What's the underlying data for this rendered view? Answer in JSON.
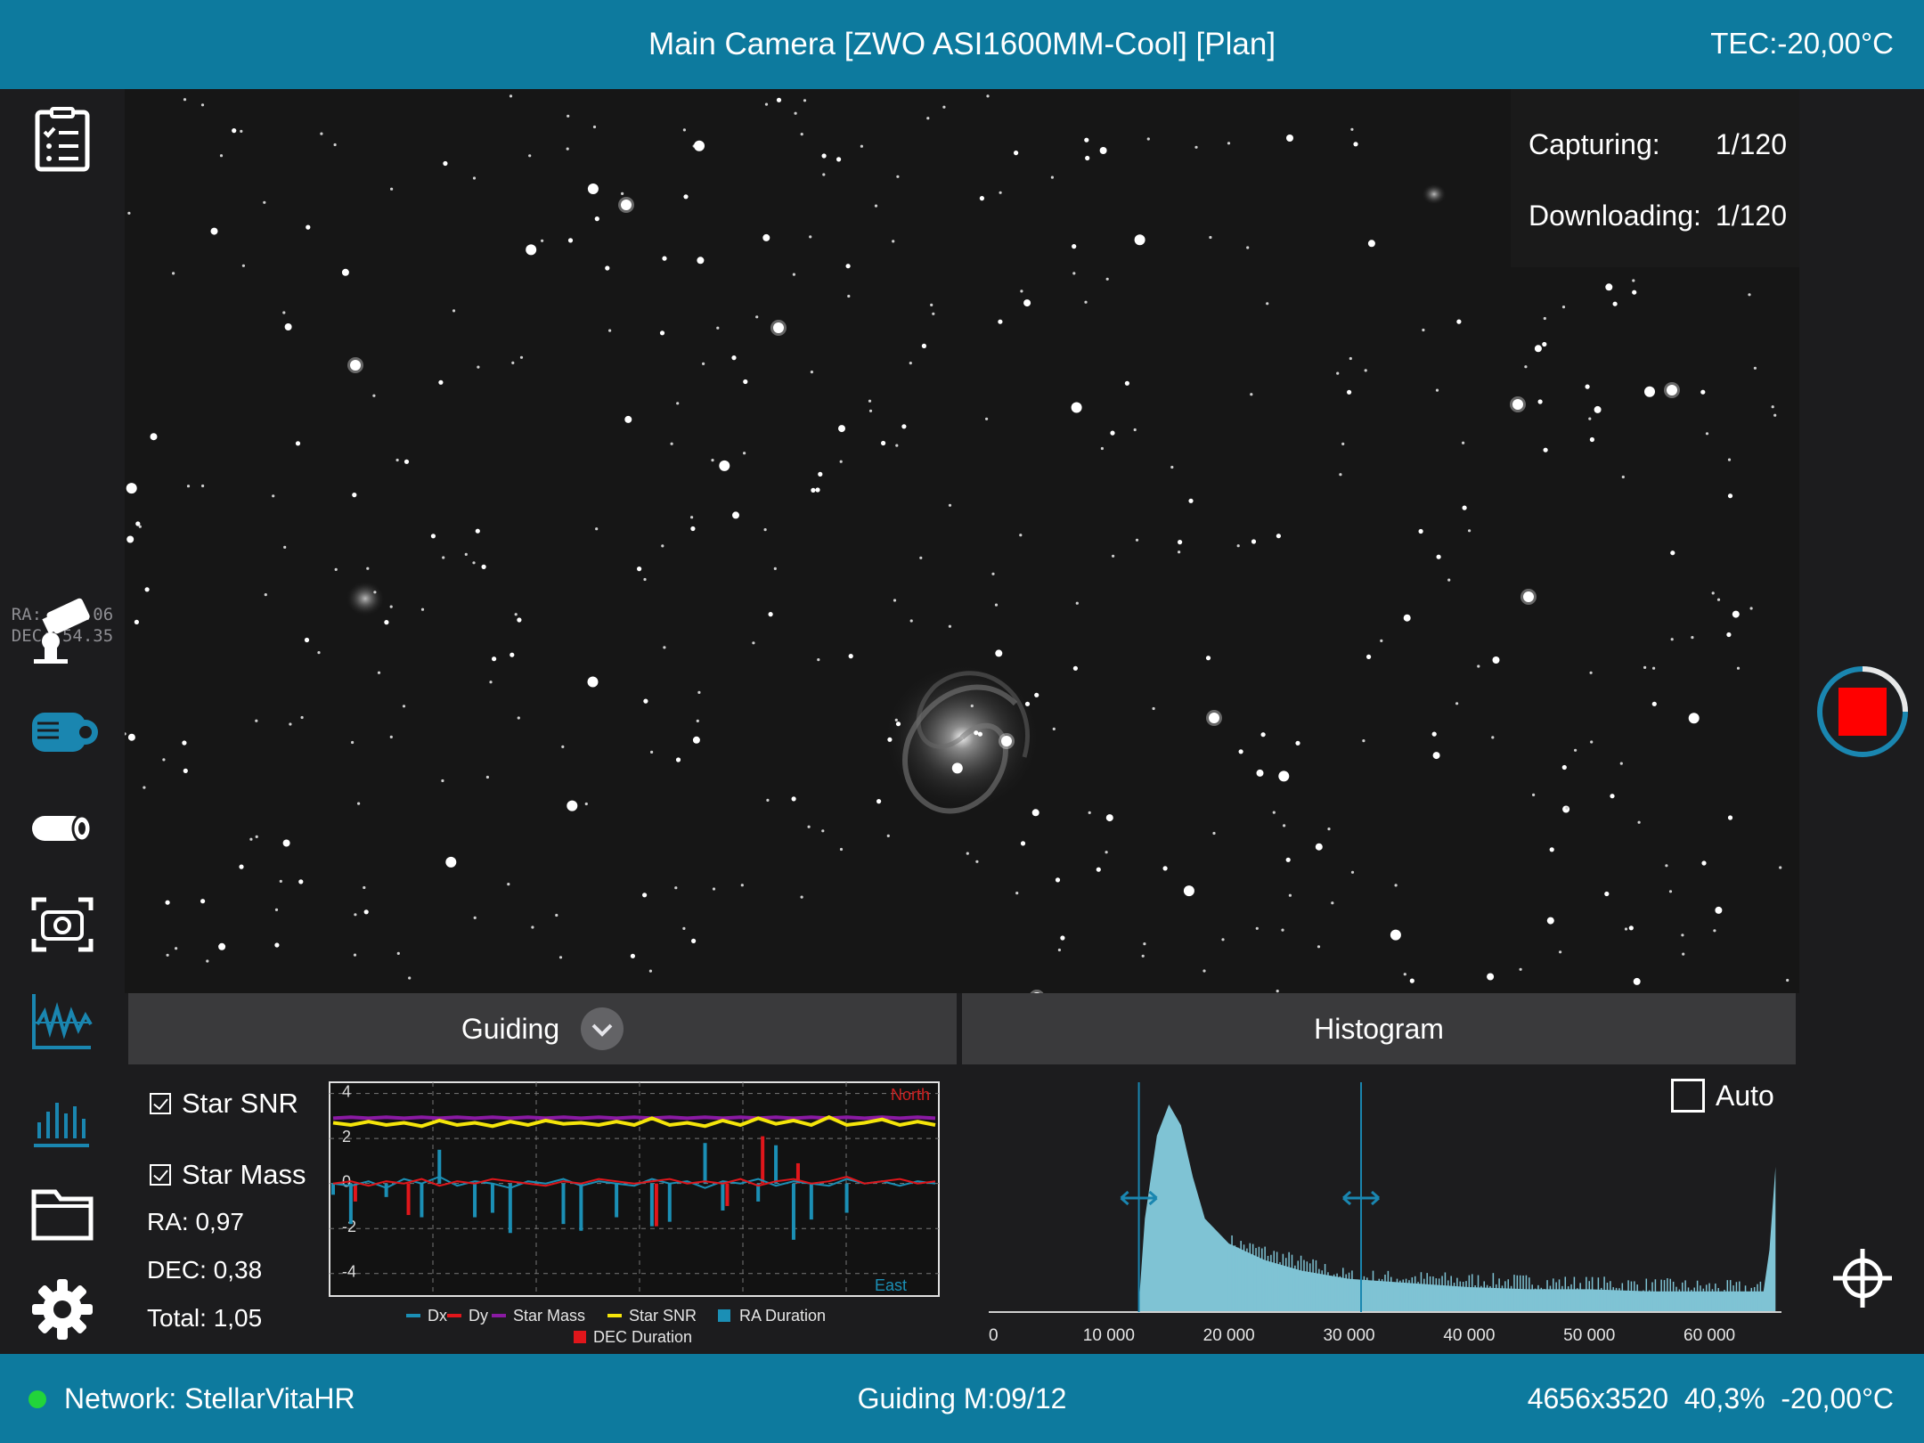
{
  "header": {
    "title": "Main Camera [ZWO ASI1600MM-Cool] [Plan]",
    "tec": "TEC:-20,00°C"
  },
  "sidebar": {
    "coords_ra": "RA:  14.06",
    "coords_dec": "DEC: 54.35",
    "icons": [
      "checklist-icon",
      "mount-icon",
      "camera-icon",
      "focuser-icon",
      "capture-focus-icon",
      "guiding-graph-icon",
      "histogram-icon",
      "folder-icon",
      "settings-gear-icon"
    ],
    "accent_color": "#1a86b0"
  },
  "capture_status": {
    "capturing_label": "Capturing:",
    "capturing_value": "1/120",
    "downloading_label": "Downloading:",
    "downloading_value": "1/120"
  },
  "guiding": {
    "header_label": "Guiding",
    "star_snr_label": "Star SNR",
    "star_mass_label": "Star Mass",
    "ra": "RA: 0,97",
    "dec": "DEC: 0,38",
    "total": "Total: 1,05",
    "north_label": "North",
    "east_label": "East"
  },
  "histogram": {
    "header_label": "Histogram",
    "auto_label": "Auto",
    "auto_checked": false
  },
  "statusbar": {
    "network": "Network: StellarVitaHR",
    "guiding": "Guiding M:09/12",
    "image_info": "4656x3520  40,3%  -20,00°C",
    "network_color": "#22d43a"
  },
  "chart_data": [
    {
      "type": "line",
      "title": "",
      "ylim": [
        -5,
        4.5
      ],
      "y_ticks": [
        "4",
        "2",
        "0",
        "-2",
        "-4"
      ],
      "legend": [
        "Dx",
        "Dy",
        "Star Mass",
        "Star SNR",
        "RA Duration",
        "DEC Duration"
      ],
      "legend_placement": "bottom",
      "colors": {
        "Dx": "#1b8fb5",
        "Dy": "#e0161b",
        "Star Mass": "#8a1aa3",
        "Star SNR": "#f5e50a",
        "RA Duration": "#1b8fb5",
        "DEC Duration": "#e0161b"
      },
      "series": [
        {
          "name": "Star SNR",
          "values": [
            2.7,
            2.6,
            2.75,
            2.6,
            2.7,
            2.55,
            2.8,
            2.6,
            2.7,
            2.55,
            2.75,
            2.6,
            2.8,
            2.65,
            2.7,
            2.6,
            2.75,
            2.6,
            2.9,
            2.6,
            2.7,
            2.55,
            2.8,
            2.6,
            2.9,
            2.65,
            2.8,
            2.6,
            2.95,
            2.6,
            2.7,
            2.85,
            2.6,
            2.75,
            2.6
          ]
        },
        {
          "name": "Star Mass",
          "values": [
            2.9,
            2.95,
            2.9,
            2.95,
            2.9,
            2.95,
            2.9,
            2.95,
            2.9,
            2.95,
            2.9,
            2.95,
            2.9,
            2.95,
            2.9,
            2.95,
            2.9,
            2.95,
            2.9,
            2.95,
            2.9,
            2.95,
            2.9,
            2.95,
            2.9,
            2.95,
            2.9,
            2.95,
            2.9,
            2.95,
            2.9,
            2.95,
            2.9,
            2.95,
            2.9
          ]
        },
        {
          "name": "Dx",
          "values": [
            0,
            -0.1,
            0.1,
            -0.2,
            0.2,
            0,
            0.3,
            -0.1,
            0.1,
            0,
            -0.2,
            0.1,
            0,
            0.2,
            -0.1,
            0.1,
            0,
            -0.1,
            0.2,
            0,
            0.1,
            -0.2,
            0.1,
            0,
            0.2,
            -0.1,
            0.1,
            0,
            -0.1,
            0.2,
            0,
            0.1,
            -0.1,
            0.1,
            0
          ]
        },
        {
          "name": "Dy",
          "values": [
            0,
            0.1,
            -0.1,
            0.1,
            0,
            0.2,
            -0.1,
            0.1,
            0,
            0.2,
            0.1,
            0,
            -0.1,
            0.1,
            0,
            0.2,
            0.1,
            0,
            0.1,
            0.2,
            0,
            0.1,
            0,
            0.2,
            -0.1,
            0.1,
            0.2,
            0,
            0.1,
            0.3,
            0,
            0.1,
            0.2,
            0,
            0.1
          ]
        },
        {
          "name": "RA Duration",
          "values": [
            -0.5,
            -1.8,
            0,
            -0.6,
            0,
            -1.5,
            1.5,
            0,
            -1.5,
            -1.3,
            -2.2,
            0,
            0,
            -1.8,
            -2.1,
            0,
            -1.5,
            0,
            -1.9,
            -1.7,
            0,
            1.8,
            -1.2,
            0,
            -0.8,
            1.7,
            -2.5,
            -1.6,
            0,
            -1.3,
            0,
            0,
            0,
            0,
            0
          ]
        },
        {
          "name": "DEC Duration",
          "values": [
            0,
            -0.8,
            0,
            0,
            -1.4,
            0,
            0,
            0,
            0,
            0,
            0,
            0,
            0,
            0,
            0,
            0,
            0,
            0,
            -1.9,
            0,
            0,
            0,
            -1.0,
            0,
            2.1,
            0,
            0.9,
            0,
            0,
            0,
            0,
            0,
            0,
            0,
            0
          ]
        }
      ]
    },
    {
      "type": "area",
      "title": "",
      "xlim": [
        0,
        66000
      ],
      "x_ticks": [
        "0",
        "10 000",
        "20 000",
        "30 000",
        "40 000",
        "50 000",
        "60 000"
      ],
      "black_point": 12500,
      "white_point": 31000,
      "color": "#7fc3d4",
      "series": [
        {
          "name": "",
          "x": [
            12500,
            13000,
            14000,
            15000,
            16000,
            17000,
            18000,
            20000,
            23000,
            26000,
            30000,
            35000,
            40000,
            45000,
            50000,
            55000,
            60000,
            64500,
            65000,
            65500
          ],
          "values": [
            0.04,
            0.45,
            0.85,
            1.0,
            0.9,
            0.65,
            0.45,
            0.33,
            0.25,
            0.2,
            0.16,
            0.14,
            0.12,
            0.11,
            0.11,
            0.1,
            0.1,
            0.1,
            0.3,
            0.7
          ]
        }
      ]
    }
  ]
}
